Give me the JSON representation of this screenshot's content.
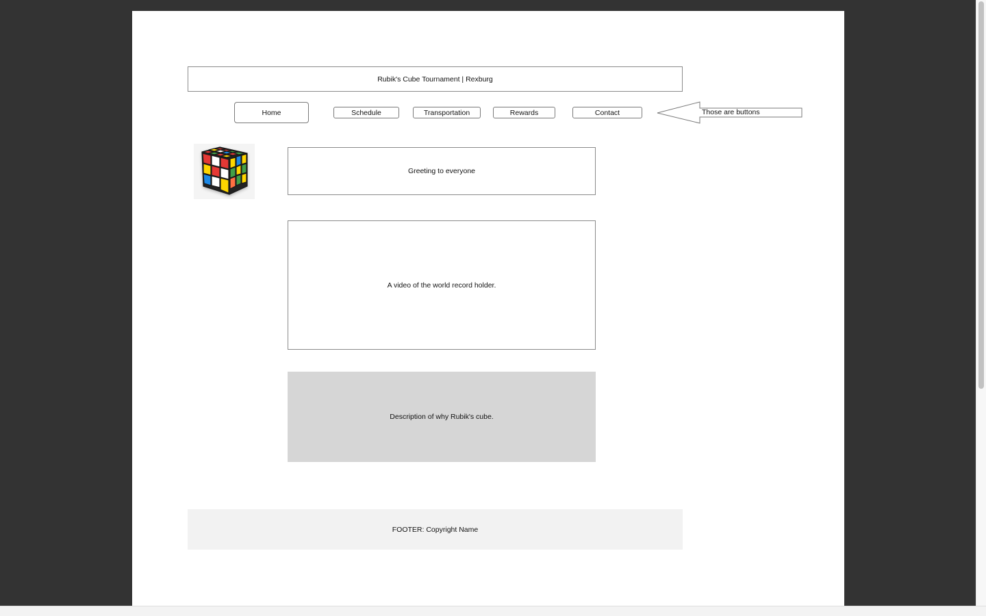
{
  "header": {
    "title": "Rubik's Cube Tournament | Rexburg"
  },
  "nav": {
    "items": [
      {
        "label": "Home"
      },
      {
        "label": "Schedule"
      },
      {
        "label": "Transportation"
      },
      {
        "label": "Rewards"
      },
      {
        "label": "Contact"
      }
    ],
    "callout": "Those are buttons"
  },
  "main": {
    "greeting": "Greeting to everyone",
    "video": "A video of the world record holder.",
    "description": "Description of why Rubik's cube."
  },
  "footer": {
    "text": "FOOTER: Copyright Name"
  },
  "colors": {
    "background": "#333333",
    "page": "#ffffff",
    "description_box": "#d6d6d6",
    "footer_box": "#f2f2f2"
  },
  "logo": {
    "icon": "rubiks-cube-icon"
  }
}
